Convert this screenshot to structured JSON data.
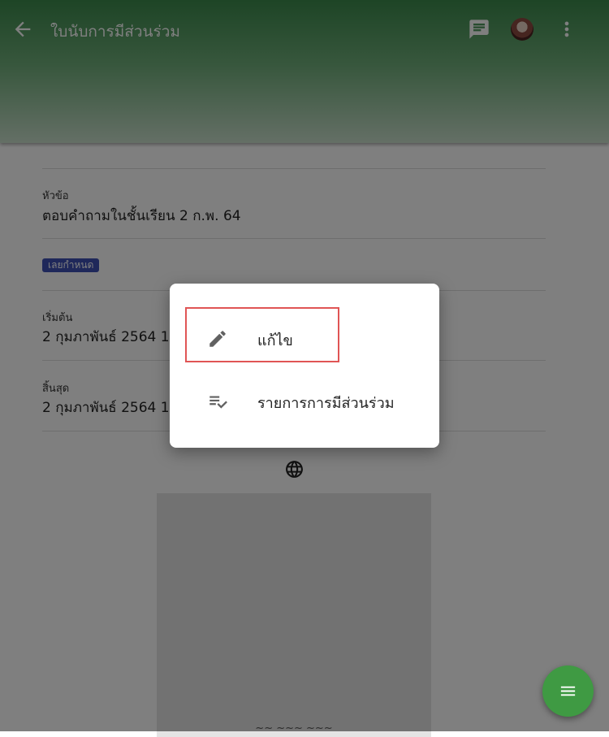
{
  "appbar": {
    "title": "ใบนับการมีส่วนร่วม",
    "icons": [
      "back-arrow-icon",
      "chat-icon",
      "avatar",
      "more-vert-icon"
    ]
  },
  "details": {
    "topic_label": "หัวข้อ",
    "topic_value": "ตอบคำถามในชั้นเรียน 2 ก.พ. 64",
    "status_badge": "เลยกำหนด",
    "start_label": "เริ่มต้น",
    "start_value": "2 กุมภาพันธ์ 2564 14",
    "end_label": "สิ้นสุด",
    "end_value": "2 กุมภาพันธ์ 2564 16",
    "preview_caption": "~~ ~~~ ~~~"
  },
  "dialog": {
    "items": [
      {
        "label": "แก้ไข",
        "icon": "pencil-icon"
      },
      {
        "label": "รายการการมีส่วนร่วม",
        "icon": "playlist-check-icon"
      }
    ]
  },
  "colors": {
    "appbar": "#3c8a4c",
    "badge": "#3f51b5",
    "fab": "#3f9a43",
    "highlight": "#e05555"
  }
}
